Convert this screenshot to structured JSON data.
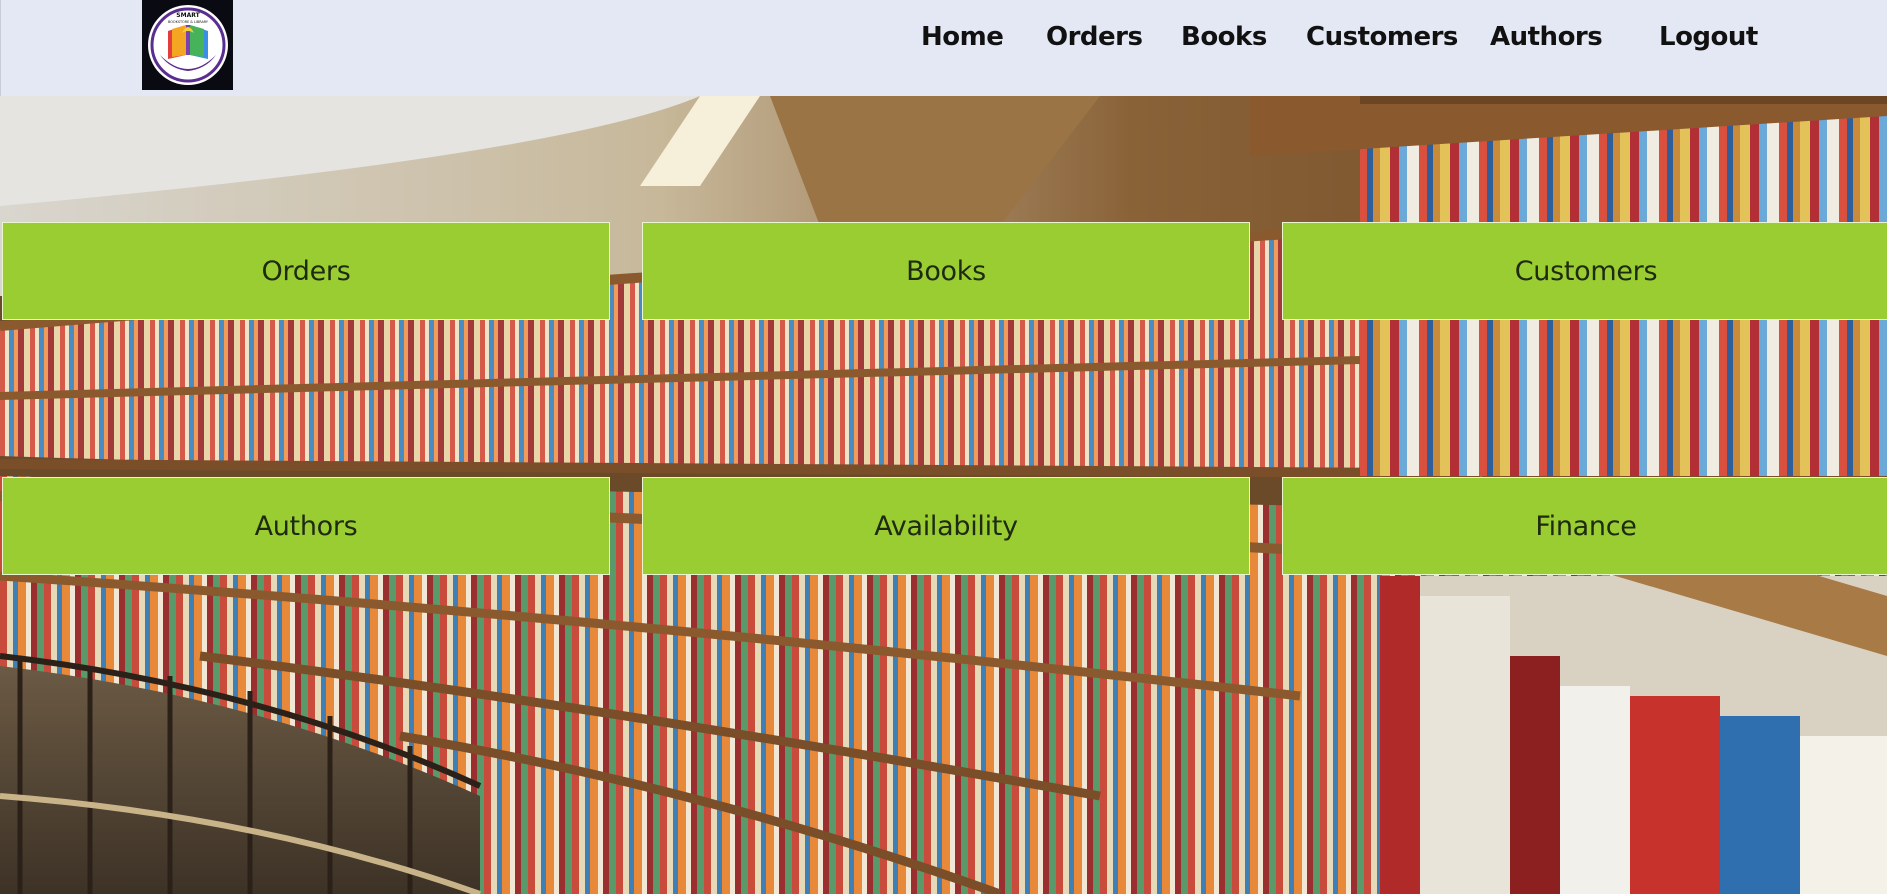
{
  "header": {
    "logo": {
      "text_top": "SMART",
      "text_sub": "BOOKSTORE & LIBRARY",
      "text_bottom": "SINCE 2024"
    },
    "nav": [
      {
        "label": "Home"
      },
      {
        "label": "Orders"
      },
      {
        "label": "Books"
      },
      {
        "label": "Customers"
      },
      {
        "label": "Authors"
      },
      {
        "label": "Logout"
      }
    ]
  },
  "hero": {
    "background": "library-bookshelves-photo"
  },
  "tiles": [
    {
      "label": "Orders"
    },
    {
      "label": "Books"
    },
    {
      "label": "Customers"
    },
    {
      "label": "Authors"
    },
    {
      "label": "Availability"
    },
    {
      "label": "Finance"
    }
  ],
  "colors": {
    "navbar_bg": "#e4e8f4",
    "tile_bg": "#9acd32",
    "tile_text": "#1e2a12"
  }
}
